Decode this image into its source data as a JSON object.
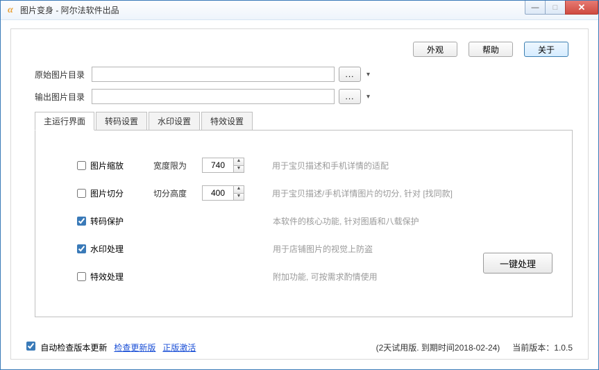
{
  "window": {
    "title": "图片变身 - 阿尔法软件出品"
  },
  "buttons": {
    "appearance": "外观",
    "help": "帮助",
    "about": "关于",
    "browse": "...",
    "process": "一键处理"
  },
  "paths": {
    "source_label": "原始图片目录",
    "source_value": "",
    "output_label": "输出图片目录",
    "output_value": ""
  },
  "tabs": {
    "main": "主运行界面",
    "transcode": "转码设置",
    "watermark": "水印设置",
    "effects": "特效设置"
  },
  "options": {
    "scale": {
      "label": "图片缩放",
      "checked": false,
      "param_label": "宽度限为",
      "value": "740",
      "hint": "用于宝贝描述和手机详情的适配"
    },
    "split": {
      "label": "图片切分",
      "checked": false,
      "param_label": "切分高度",
      "value": "400",
      "hint": "用于宝贝描述/手机详情图片的切分, 针对 [找同款]"
    },
    "protect": {
      "label": "转码保护",
      "checked": true,
      "hint": "本软件的核心功能, 针对图盾和八载保护"
    },
    "wm": {
      "label": "水印处理",
      "checked": true,
      "hint": "用于店铺图片的视觉上防盗"
    },
    "fx": {
      "label": "特效处理",
      "checked": false,
      "hint": "附加功能, 可按需求酌情使用"
    }
  },
  "footer": {
    "auto_update_label": "自动检查版本更新",
    "auto_update_checked": true,
    "check_update_link": "检查更新版",
    "activate_link": "正版激活",
    "trial_text": "(2天试用版. 到期时间2018-02-24)",
    "version_text": "当前版本：1.0.5"
  }
}
